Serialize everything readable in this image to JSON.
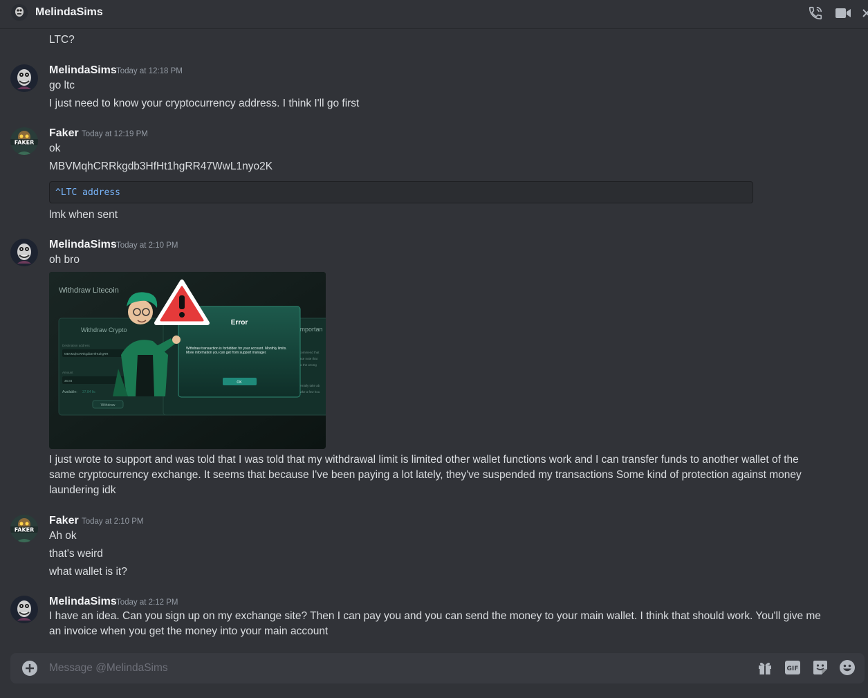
{
  "header": {
    "username": "MelindaSims"
  },
  "messages": {
    "m0_line0": "LTC?",
    "g1": {
      "author": "MelindaSims",
      "time": "Today at 12:18 PM",
      "lines": [
        "go ltc",
        "I  just need to know your cryptocurrency address. I think I'll go first"
      ]
    },
    "g2": {
      "author": "Faker",
      "avatar_text": "FAKER",
      "time": "Today at 12:19 PM",
      "lines": [
        "ok",
        "MBVMqhCRRkgdb3HfHt1hgRR47WwL1nyo2K"
      ],
      "code": "^LTC address",
      "after": "lmk when sent"
    },
    "g3": {
      "author": "MelindaSims",
      "time": "Today at 2:10 PM",
      "lines": [
        "oh bro"
      ],
      "attachment": {
        "header": "Withdraw Litecoin",
        "panel_title": "Withdraw Crypto",
        "dest_label": "Destination address",
        "dest_value": "MBVMqhCRRkgdb3HfHt1hgRR",
        "amount_label": "Amount",
        "amount_value": "36.84",
        "available_label": "Available:",
        "available_value": "37.84 ltc",
        "withdraw_button": "Withdraw",
        "error_title": "Error",
        "error_text": "Withdraw transaction is forbidden for your account. Monthly limits. More information you can get from support manager.",
        "ok_button": "OK",
        "side_title": "Importan",
        "side_lines": [
          "commend that",
          "ase note that",
          "to the wrong",
          "ernally take ab",
          "take a few hou"
        ]
      },
      "paragraph": "I just wrote to support and was told that I was told that my withdrawal limit is limited other wallet functions work and I can transfer funds to another wallet of the same cryptocurrency exchange. It seems that because I've been paying a lot lately, they've suspended my transactions Some kind of protection against money laundering idk"
    },
    "g4": {
      "author": "Faker",
      "avatar_text": "FAKER",
      "time": "Today at 2:10 PM",
      "lines": [
        "Ah ok",
        "that's weird",
        "what wallet is it?"
      ]
    },
    "g5": {
      "author": "MelindaSims",
      "time": "Today at 2:12 PM",
      "paragraph": "I have an idea. Can you sign up on my exchange site? Then I can pay you and you can send the money to your main wallet. I think that should work. You'll give me an invoice when you get the money into your main account"
    }
  },
  "composer": {
    "placeholder": "Message @MelindaSims"
  },
  "icons": {
    "call": "phone-call-icon",
    "video": "video-camera-icon",
    "gift": "gift-icon",
    "gif": "GIF",
    "sticker": "sticker-icon",
    "emoji": "emoji-icon",
    "plus": "plus-circle-icon"
  },
  "colors": {
    "background": "#313338",
    "composer": "#383a40",
    "code_text": "#7ab8ff",
    "attachment_accent": "#1f8a7a"
  }
}
